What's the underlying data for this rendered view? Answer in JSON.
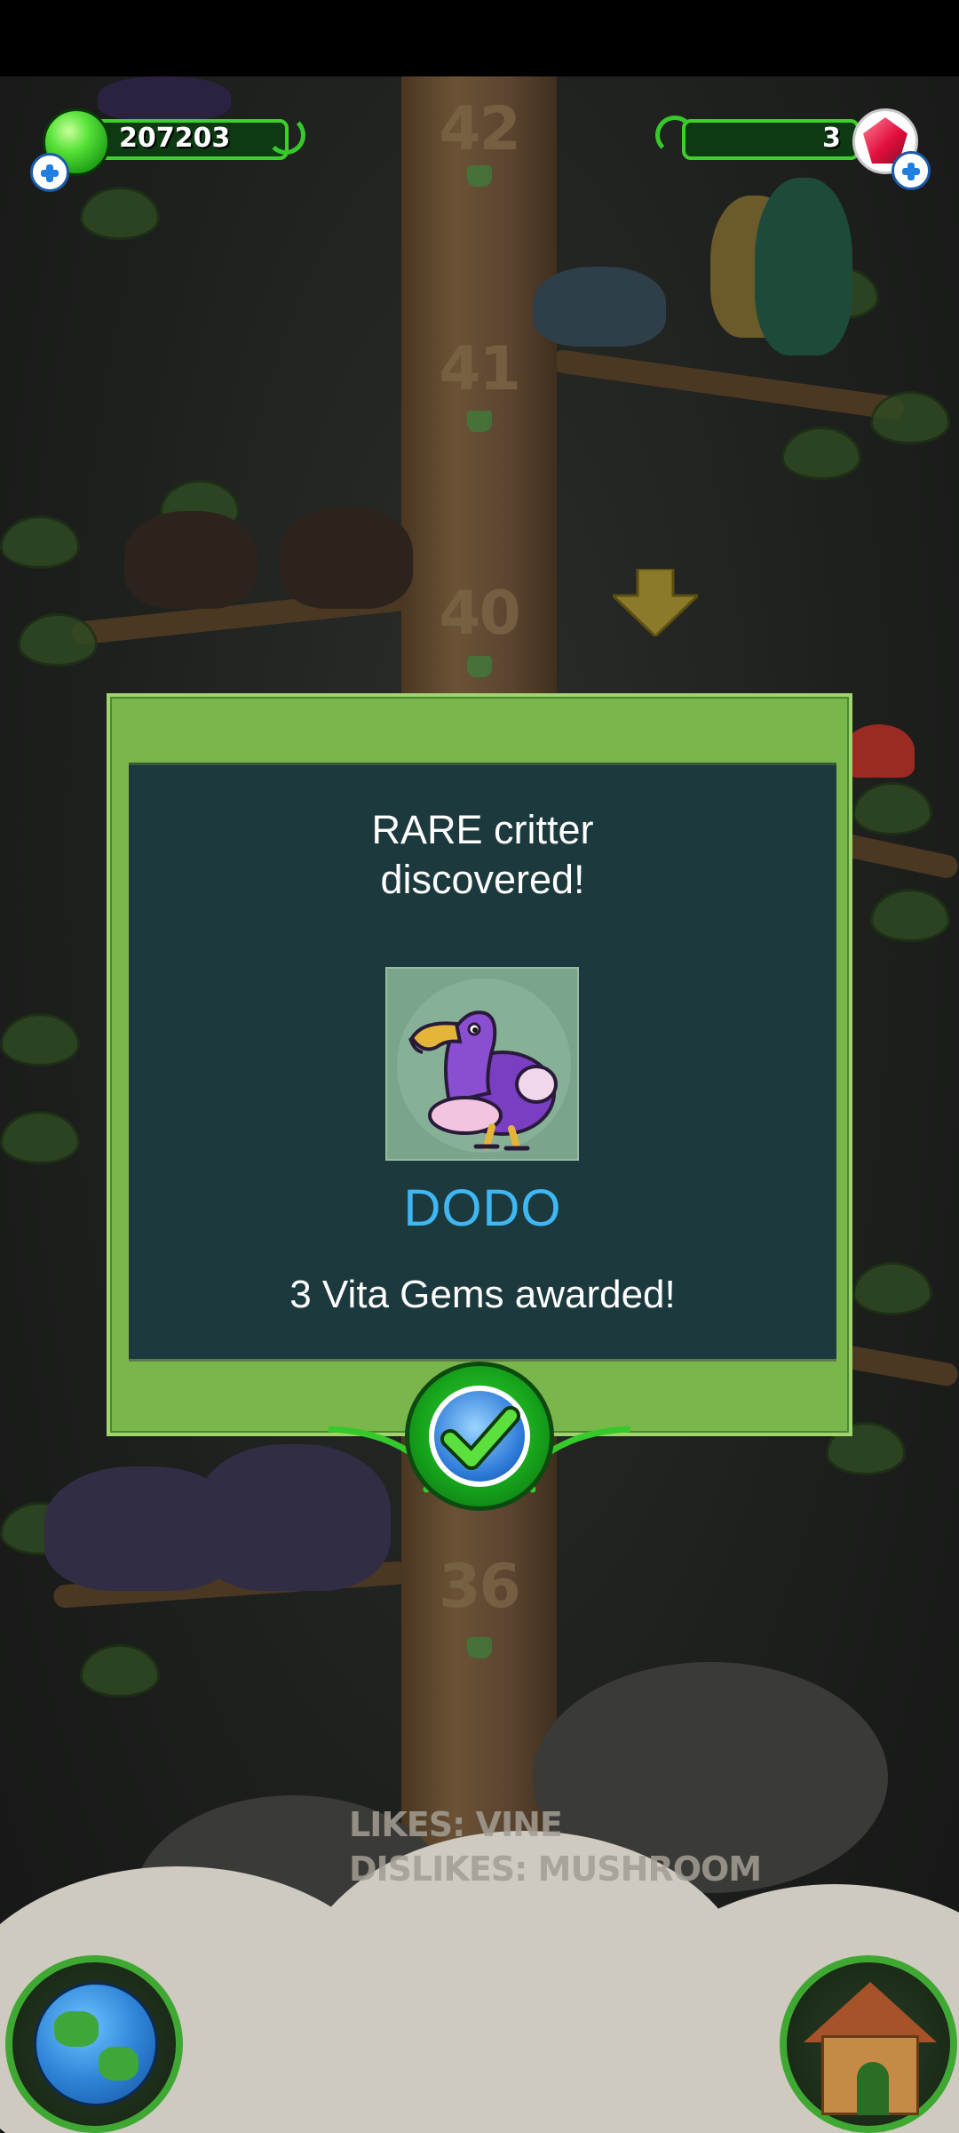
{
  "hud": {
    "green_gem_count": "207203",
    "red_gem_count": "3"
  },
  "trunk_levels": [
    "42",
    "41",
    "40",
    "36"
  ],
  "dialog": {
    "heading_line1": "RARE critter",
    "heading_line2": "discovered!",
    "critter_name": "DODO",
    "award_text": "3 Vita Gems awarded!"
  },
  "critter_info": {
    "likes": "LIKES: VINE",
    "dislikes": "DISLIKES: MUSHROOM"
  },
  "colors": {
    "dialog_frame": "#7bb64d",
    "dialog_panel": "#1c393e",
    "critter_name": "#3fb7f3",
    "hud_green": "#3fcf2c"
  },
  "icons": {
    "green_gem": "green-gem-icon",
    "red_gem": "red-gem-icon",
    "add": "plus-icon",
    "confirm": "checkmark-icon",
    "map": "globe-icon",
    "home": "house-icon",
    "down_arrow": "arrow-down-icon"
  }
}
